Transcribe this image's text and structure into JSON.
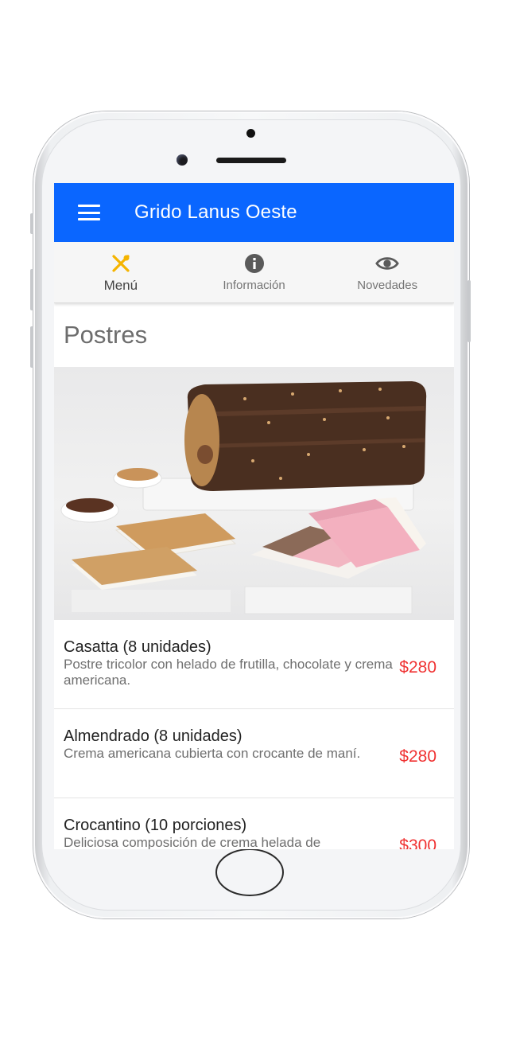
{
  "app": {
    "title": "Grido Lanus Oeste"
  },
  "tabs": [
    {
      "label": "Menú",
      "icon": "utensils-icon",
      "active": true
    },
    {
      "label": "Información",
      "icon": "info-icon",
      "active": false
    },
    {
      "label": "Novedades",
      "icon": "eye-icon",
      "active": false
    }
  ],
  "section": {
    "title": "Postres"
  },
  "items": [
    {
      "name": "Casatta (8 unidades)",
      "description": "Postre tricolor con helado de frutilla, chocolate y crema americana.",
      "price": "$280"
    },
    {
      "name": "Almendrado (8 unidades)",
      "description": "Crema americana cubierta con crocante de maní.",
      "price": "$280"
    },
    {
      "name": "Crocantino (10 porciones)",
      "description": "Deliciosa composición de crema helada de",
      "price": "$300"
    }
  ],
  "colors": {
    "appbar": "#0a66ff",
    "price": "#f03232",
    "active_tab_icon": "#f5b400",
    "tab_icon": "#5a5a5a"
  }
}
